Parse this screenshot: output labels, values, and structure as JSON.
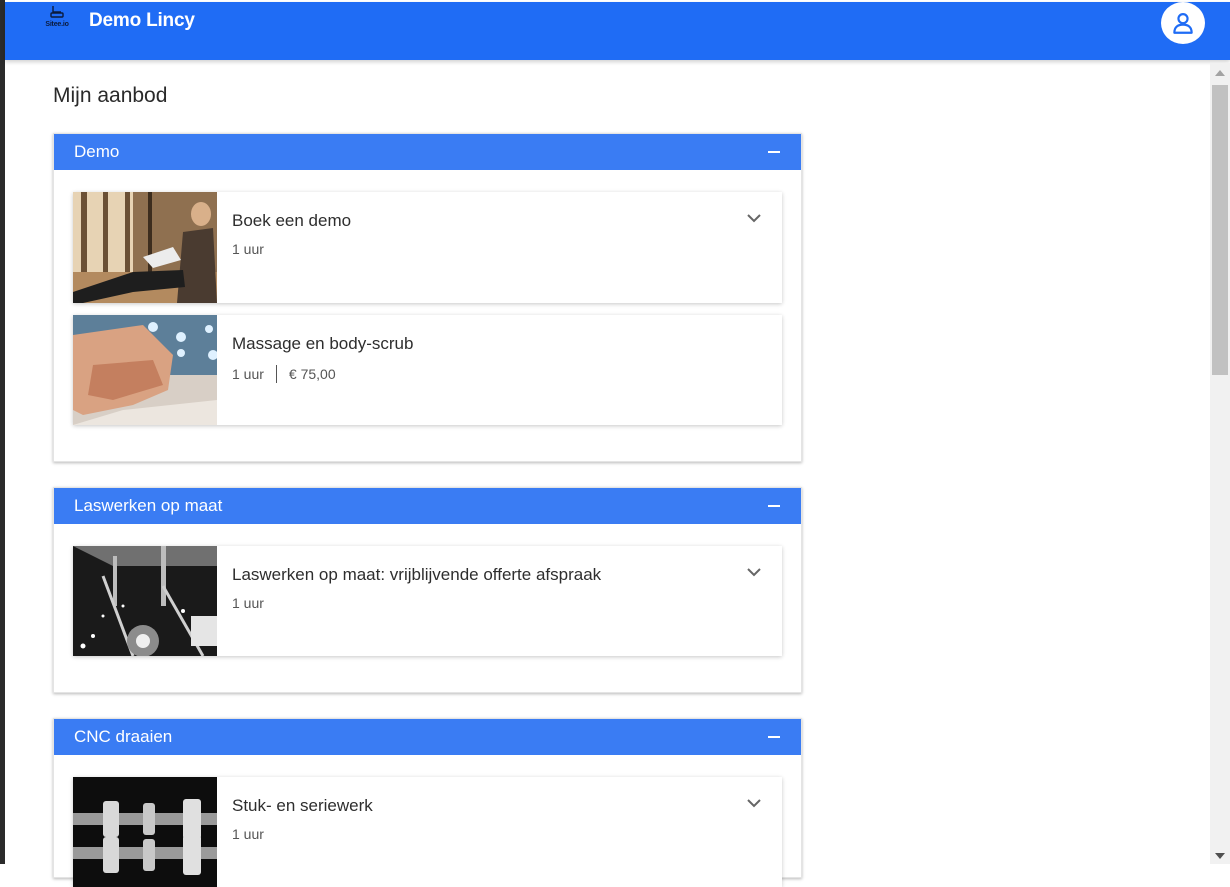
{
  "app": {
    "brand": "Demo Lincy",
    "logo_text": "Sitee.io"
  },
  "page": {
    "title": "Mijn aanbod"
  },
  "categories": [
    {
      "name": "Demo",
      "services": [
        {
          "title": "Boek een demo",
          "duration": "1 uur",
          "price": ""
        },
        {
          "title": "Massage en body-scrub",
          "duration": "1 uur",
          "price": "€ 75,00"
        }
      ]
    },
    {
      "name": "Laswerken op maat",
      "services": [
        {
          "title": "Laswerken op maat: vrijblijvende offerte afspraak",
          "duration": "1 uur",
          "price": ""
        }
      ]
    },
    {
      "name": "CNC draaien",
      "services": [
        {
          "title": "Stuk- en seriewerk",
          "duration": "1 uur",
          "price": ""
        }
      ]
    }
  ],
  "icons": {
    "user": "user-icon",
    "collapse": "minus-icon",
    "expand": "chevron-down-icon"
  },
  "colors": {
    "topbar": "#1f6cf5",
    "category_header": "#3a7cf3"
  }
}
